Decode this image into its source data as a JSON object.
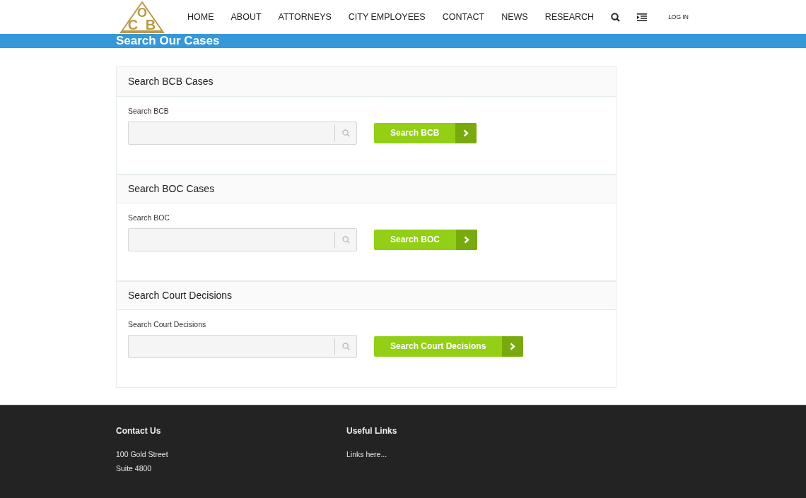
{
  "logo": {
    "letters": [
      "O",
      "C",
      "B"
    ]
  },
  "nav": {
    "items": [
      {
        "label": "HOME",
        "selected": false
      },
      {
        "label": "ABOUT",
        "selected": false
      },
      {
        "label": "ATTORNEYS",
        "selected": false
      },
      {
        "label": "CITY EMPLOYEES",
        "selected": false
      },
      {
        "label": "CONTACT",
        "selected": false
      },
      {
        "label": "NEWS",
        "selected": false
      },
      {
        "label": "RESEARCH",
        "selected": false
      }
    ],
    "login": "LOG IN"
  },
  "page_title": "Search Our Cases",
  "panels": [
    {
      "title": "Search BCB Cases",
      "label": "Search BCB",
      "button": "Search BCB"
    },
    {
      "title": "Search BOC Cases",
      "label": "Search BOC",
      "button": "Search BOC"
    },
    {
      "title": "Search Court Decisions",
      "label": "Search Court Decisions",
      "button": "Search Court Decisions"
    }
  ],
  "footer": {
    "columns": [
      {
        "heading": "Contact Us",
        "lines": [
          "100 Gold Street",
          "Suite 4800"
        ]
      },
      {
        "heading": "Useful Links",
        "lines": [
          "Links here..."
        ]
      }
    ]
  }
}
